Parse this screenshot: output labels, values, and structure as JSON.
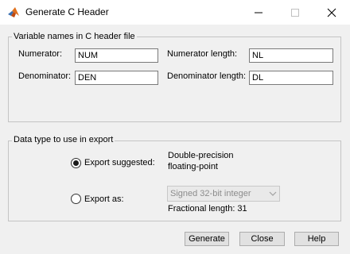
{
  "window": {
    "title": "Generate C Header",
    "app_icon": "matlab-icon"
  },
  "variable_names_panel": {
    "title": "Variable names in C header file",
    "numerator_label": "Numerator:",
    "numerator_value": "NUM",
    "numerator_length_label": "Numerator length:",
    "numerator_length_value": "NL",
    "denominator_label": "Denominator:",
    "denominator_value": "DEN",
    "denominator_length_label": "Denominator length:",
    "denominator_length_value": "DL"
  },
  "data_type_panel": {
    "title": "Data type to use in export",
    "export_suggested_label": "Export suggested:",
    "export_suggested_selected": true,
    "suggested_type_line1": "Double-precision",
    "suggested_type_line2": "floating-point",
    "export_as_label": "Export as:",
    "export_as_selected": false,
    "export_as_option": "Signed 32-bit integer",
    "export_as_enabled": false,
    "fractional_length": "Fractional length: 31"
  },
  "buttons": {
    "generate": "Generate",
    "close": "Close",
    "help": "Help"
  }
}
